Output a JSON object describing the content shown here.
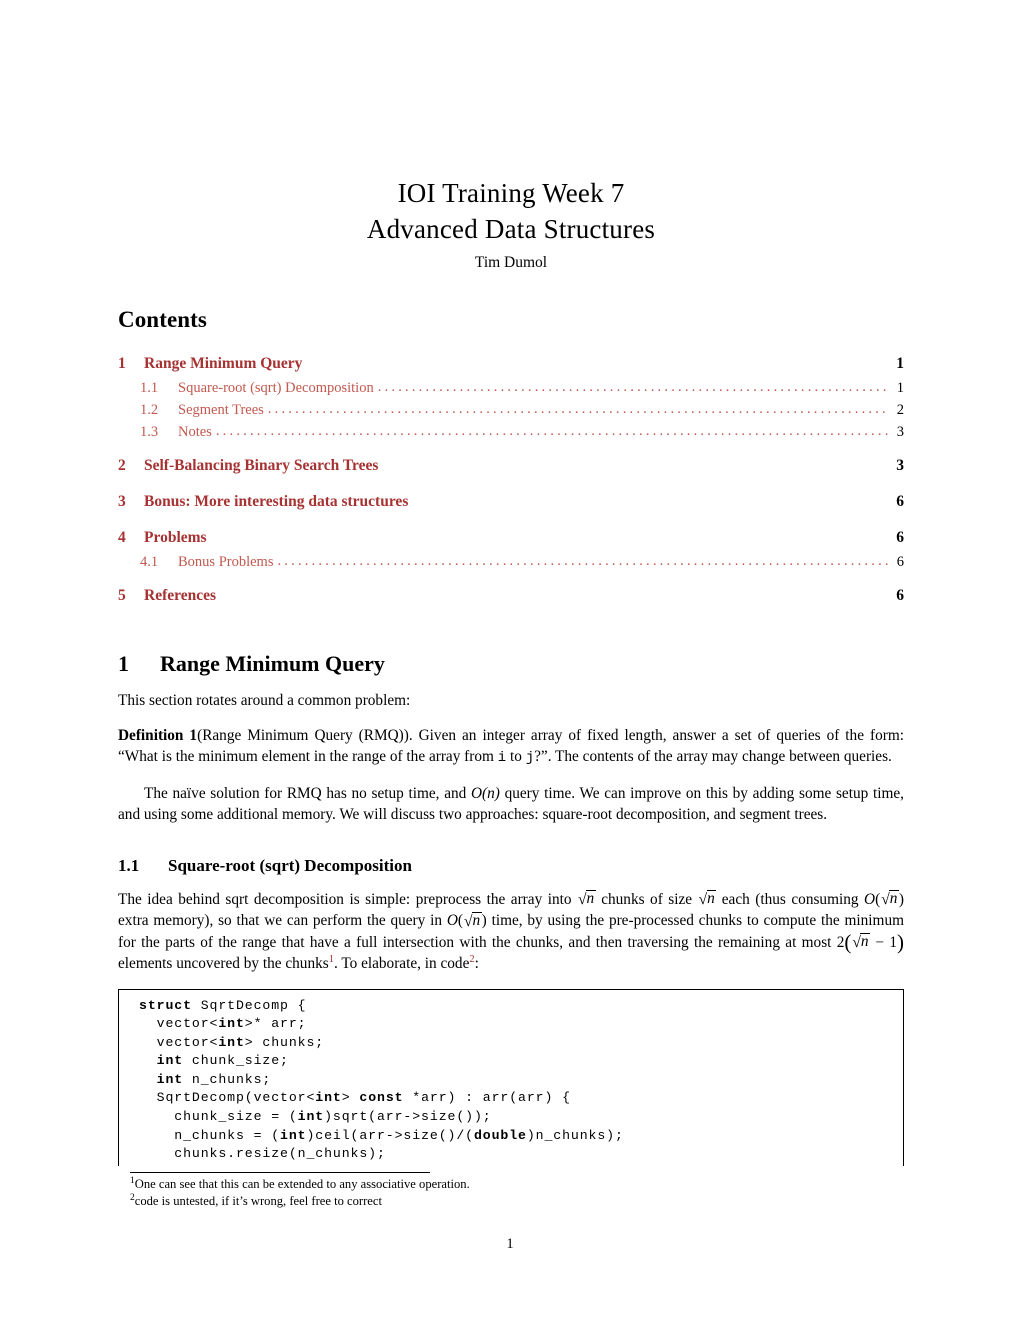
{
  "document": {
    "title_line1": "IOI Training Week 7",
    "title_line2": "Advanced Data Structures",
    "author": "Tim Dumol",
    "page_number": "1",
    "link_color": "#a63232",
    "sublink_color": "#c1594f"
  },
  "contents": {
    "heading": "Contents",
    "entries": [
      {
        "level": "section",
        "number": "1",
        "label": "Range Minimum Query",
        "page": "1"
      },
      {
        "level": "sub",
        "number": "1.1",
        "label": "Square-root (sqrt) Decomposition",
        "page": "1"
      },
      {
        "level": "sub",
        "number": "1.2",
        "label": "Segment Trees",
        "page": "2"
      },
      {
        "level": "sub",
        "number": "1.3",
        "label": "Notes",
        "page": "3"
      },
      {
        "level": "section",
        "number": "2",
        "label": "Self-Balancing Binary Search Trees",
        "page": "3"
      },
      {
        "level": "section",
        "number": "3",
        "label": "Bonus: More interesting data structures",
        "page": "6"
      },
      {
        "level": "section",
        "number": "4",
        "label": "Problems",
        "page": "6"
      },
      {
        "level": "sub",
        "number": "4.1",
        "label": "Bonus Problems",
        "page": "6"
      },
      {
        "level": "section",
        "number": "5",
        "label": "References",
        "page": "6"
      }
    ]
  },
  "section1": {
    "number": "1",
    "title": "Range Minimum Query",
    "intro": "This section rotates around a common problem:",
    "definition": {
      "label": "Definition 1",
      "name": "(Range Minimum Query (RMQ)).",
      "text_before_i": " Given an integer array of fixed length, answer a set of queries of the form: “What is the minimum element in the range of the array from ",
      "var_i": "i",
      "text_mid": " to ",
      "var_j": "j",
      "text_after": "?”. The contents of the array may change between queries."
    },
    "naive_p1": "The naïve solution for RMQ has no setup time, and ",
    "naive_math": "O(n)",
    "naive_p2": " query time. We can improve on this by adding some setup time, and using some additional memory. We will discuss two approaches: square-root decomposition, and segment trees."
  },
  "subsection11": {
    "number": "1.1",
    "title": "Square-root (sqrt) Decomposition",
    "t1": "The idea behind sqrt decomposition is simple: preprocess the array into ",
    "t2": " chunks of size ",
    "t3": " each (thus consuming ",
    "t4": " extra memory), so that we can perform the query in ",
    "t5": " time, by using the pre-processed chunks to compute the minimum for the parts of the range that have a full intersection with the chunks, and then traversing the remaining at most ",
    "t6_num": "2",
    "t6_minus": " − 1",
    "t7": " elements uncovered by the chunks",
    "fn1": "1",
    "t8": ". To elaborate, in code",
    "fn2": "2",
    "t9": ":",
    "sqrt_n": "n",
    "big_o": "O"
  },
  "code": {
    "lines": [
      [
        {
          "t": "struct",
          "b": true
        },
        {
          "t": " SqrtDecomp {",
          "b": false
        }
      ],
      [
        {
          "t": "  vector<",
          "b": false
        },
        {
          "t": "int",
          "b": true
        },
        {
          "t": ">* arr;",
          "b": false
        }
      ],
      [
        {
          "t": "  vector<",
          "b": false
        },
        {
          "t": "int",
          "b": true
        },
        {
          "t": "> chunks;",
          "b": false
        }
      ],
      [
        {
          "t": "  int",
          "b": true
        },
        {
          "t": " chunk_size;",
          "b": false
        }
      ],
      [
        {
          "t": "  int",
          "b": true
        },
        {
          "t": " n_chunks;",
          "b": false
        }
      ],
      [
        {
          "t": "  SqrtDecomp(vector<",
          "b": false
        },
        {
          "t": "int",
          "b": true
        },
        {
          "t": "> ",
          "b": false
        },
        {
          "t": "const",
          "b": true
        },
        {
          "t": " *arr) : arr(arr) {",
          "b": false
        }
      ],
      [
        {
          "t": "    chunk_size = (",
          "b": false
        },
        {
          "t": "int",
          "b": true
        },
        {
          "t": ")sqrt(arr->size());",
          "b": false
        }
      ],
      [
        {
          "t": "    n_chunks = (",
          "b": false
        },
        {
          "t": "int",
          "b": true
        },
        {
          "t": ")ceil(arr->size()/(",
          "b": false
        },
        {
          "t": "double",
          "b": true
        },
        {
          "t": ")n_chunks);",
          "b": false
        }
      ],
      [
        {
          "t": "    chunks.resize(n_chunks);",
          "b": false
        }
      ]
    ]
  },
  "footnotes": [
    {
      "mark": "1",
      "text": "One can see that this can be extended to any associative operation."
    },
    {
      "mark": "2",
      "text": "code is untested, if it’s wrong, feel free to correct"
    }
  ]
}
